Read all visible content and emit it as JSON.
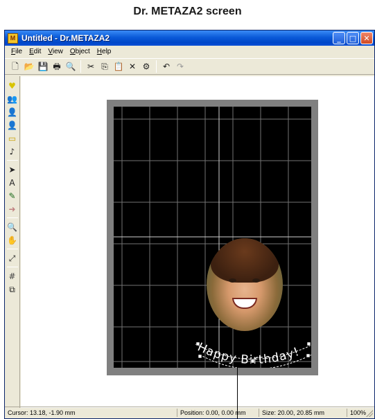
{
  "caption": "Dr. METAZA2 screen",
  "window": {
    "title": "Untitled - Dr.METAZA2",
    "app_icon_glyph": "M",
    "controls": {
      "minimize": "_",
      "maximize": "□",
      "close": "✕"
    }
  },
  "menu": [
    "File",
    "Edit",
    "View",
    "Object",
    "Help"
  ],
  "toolbar": [
    {
      "name": "new-document-icon",
      "glyph": "🗋"
    },
    {
      "name": "open-folder-icon",
      "glyph": "📂"
    },
    {
      "name": "save-icon",
      "glyph": "💾"
    },
    {
      "name": "print-icon",
      "glyph": "🖶"
    },
    {
      "name": "print-preview-icon",
      "glyph": "🔍"
    },
    {
      "name": "cut-icon",
      "glyph": "✂"
    },
    {
      "name": "copy-icon",
      "glyph": "⎘"
    },
    {
      "name": "paste-icon",
      "glyph": "📋"
    },
    {
      "name": "delete-icon",
      "glyph": "✕"
    },
    {
      "name": "properties-icon",
      "glyph": "⚙"
    },
    {
      "name": "undo-icon",
      "glyph": "↶"
    },
    {
      "name": "redo-icon",
      "glyph": "↷"
    }
  ],
  "sidebar": [
    {
      "name": "heart-icon",
      "glyph": "♥",
      "color": "#d8c400"
    },
    {
      "name": "people-icon",
      "glyph": "👥",
      "color": "#1a7a1a"
    },
    {
      "name": "portrait-icon",
      "glyph": "👤",
      "color": "#c01a6a"
    },
    {
      "name": "portrait-select-icon",
      "glyph": "👤",
      "color": "#1a3ac0"
    },
    {
      "name": "rectangle-icon",
      "glyph": "▭",
      "color": "#c8a000"
    },
    {
      "name": "music-note-icon",
      "glyph": "♪",
      "color": "#222222"
    },
    {
      "name": "pointer-icon",
      "glyph": "➤",
      "color": "#222222"
    },
    {
      "name": "text-icon",
      "glyph": "A",
      "color": "#222222"
    },
    {
      "name": "pen-icon",
      "glyph": "✎",
      "color": "#1a6a1a"
    },
    {
      "name": "arrow-right-icon",
      "glyph": "➜",
      "color": "#c08080"
    },
    {
      "name": "zoom-icon",
      "glyph": "🔍",
      "color": "#1a3ac0"
    },
    {
      "name": "hand-icon",
      "glyph": "✋",
      "color": "#c8a000"
    },
    {
      "name": "fit-icon",
      "glyph": "⤢",
      "color": "#222222"
    },
    {
      "name": "grid-icon",
      "glyph": "#",
      "color": "#444444"
    },
    {
      "name": "layers-icon",
      "glyph": "⧉",
      "color": "#222222"
    }
  ],
  "artwork": {
    "arc_text": "Happy Birthday!"
  },
  "status": {
    "cursor": "Cursor: 13.18, -1.90 mm",
    "position": "Position: 0.00, 0.00 mm",
    "size": "Size: 20.00, 20.85 mm",
    "zoom": "100%"
  }
}
